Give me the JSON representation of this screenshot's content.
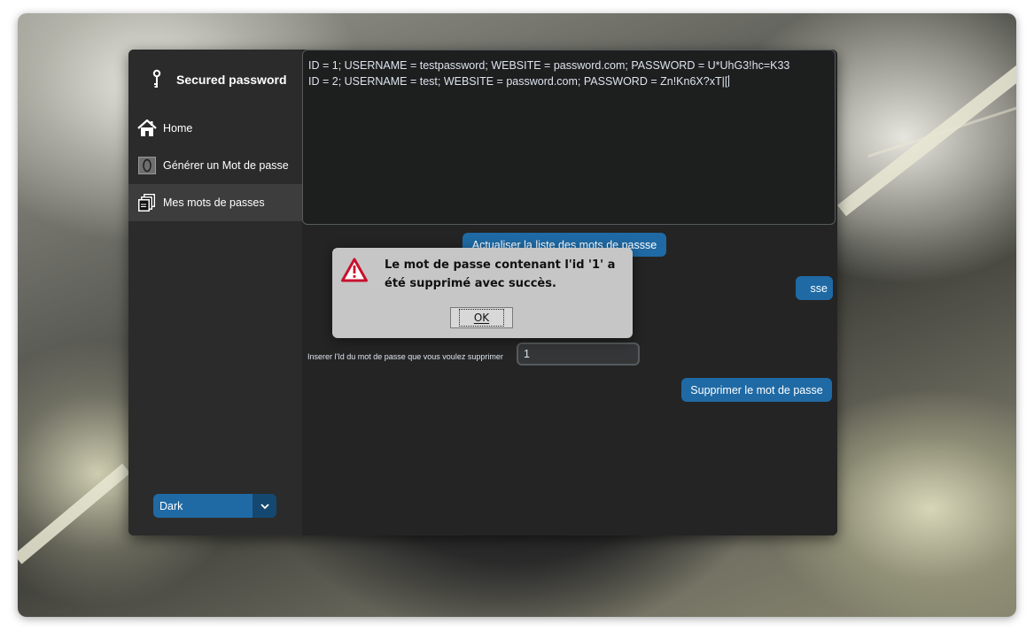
{
  "app": {
    "title": "Secured password"
  },
  "sidebar": {
    "items": [
      {
        "label": "Home",
        "icon": "home-icon"
      },
      {
        "label": "Générer un Mot de passe",
        "icon": "generate-icon"
      },
      {
        "label": "Mes mots de passes",
        "icon": "documents-icon"
      }
    ],
    "theme": {
      "value": "Dark"
    }
  },
  "main": {
    "passwords": [
      "ID = 1; USERNAME = testpassword; WEBSITE = password.com;  PASSWORD = U*UhG3!hc=K33",
      "ID = 2; USERNAME = test; WEBSITE = password.com;  PASSWORD = Zn!Kn6X?xT|["
    ],
    "refresh_button": "Actualiser la liste des mots de passse",
    "hidden_button_fragment": "sse",
    "delete_label": "Inserer l'Id du mot de passe que vous voulez supprimer",
    "delete_input_value": "1",
    "delete_button": "Supprimer le mot de passe"
  },
  "dialog": {
    "message": "Le mot de passe contenant l'id '1' a été supprimé avec succès.",
    "ok_label": "OK"
  },
  "colors": {
    "accent": "#1f6aa5",
    "window_bg": "#2b2b2b",
    "content_bg": "#242424",
    "dialog_bg": "#c6c6c6",
    "warning_red": "#c8102e"
  }
}
